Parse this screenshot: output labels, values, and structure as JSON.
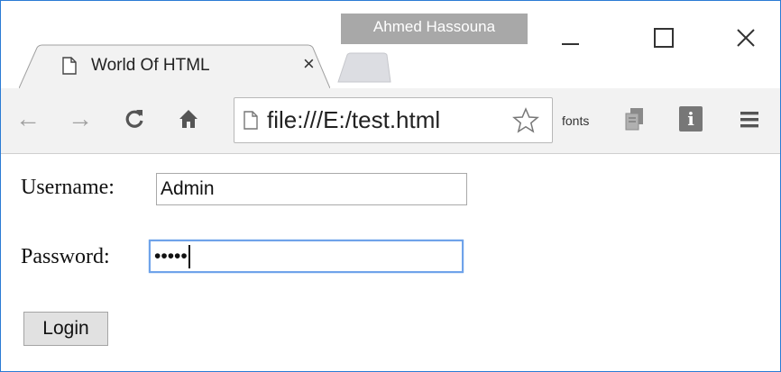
{
  "window": {
    "user_name": "Ahmed Hassouna"
  },
  "tab": {
    "title": "World Of HTML",
    "close_glyph": "×"
  },
  "toolbar": {
    "back_glyph": "←",
    "forward_glyph": "→",
    "reload_glyph": "C",
    "home_glyph": "⌂",
    "url": "file:///E:/test.html",
    "fonts_label": "fonts",
    "info_label": "i"
  },
  "form": {
    "username_label": "Username:",
    "username_value": "Admin",
    "password_label": "Password:",
    "password_mask": "•••••",
    "login_label": "Login"
  },
  "colors": {
    "window_border": "#2b7bd4",
    "focus_ring": "#6fa3ea",
    "user_badge": "#a8a8a8"
  }
}
